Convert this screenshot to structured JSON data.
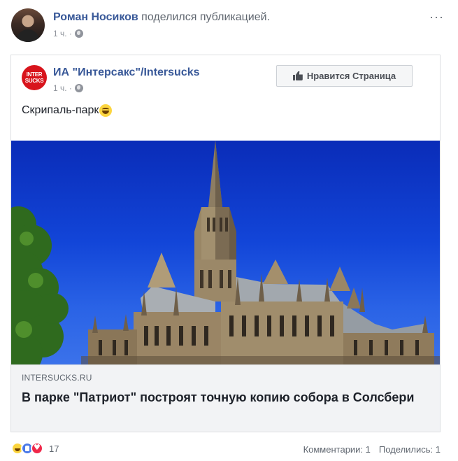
{
  "post": {
    "author_name": "Роман Носиков",
    "action_text": " поделился публикацией.",
    "time": "1 ч. ·",
    "more_label": "···"
  },
  "shared": {
    "page_name": "ИА \"Интерсакс\"/Intersucks",
    "logo_text": "INTER SUCKS",
    "time": "1 ч. ·",
    "like_page_label": "Нравится Страница",
    "text": "Скрипаль-парк",
    "link": {
      "domain": "INTERSUCKS.RU",
      "title": "В парке \"Патриот\" построят точную копию собора в Солсбери"
    }
  },
  "footer": {
    "reaction_count": "17",
    "comments": "Комментарии: 1",
    "shares": "Поделились: 1"
  },
  "icons": {
    "globe": "globe-icon",
    "thumb": "thumbs-up-icon",
    "emoji": "laughing-emoji-icon",
    "reactions": [
      "haha-reaction-icon",
      "like-reaction-icon",
      "love-reaction-icon"
    ]
  },
  "colors": {
    "link_blue": "#385898",
    "meta_gray": "#90949c",
    "sky_blue": "#1245d8",
    "logo_red": "#d8141c"
  }
}
